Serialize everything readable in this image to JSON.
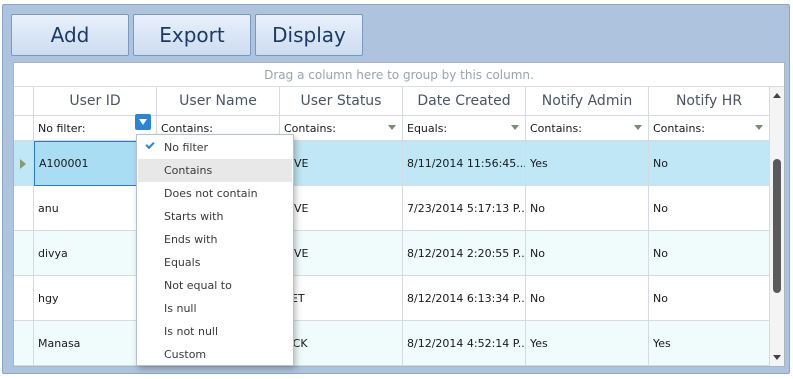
{
  "toolbar": {
    "add_label": "Add",
    "export_label": "Export",
    "display_label": "Display"
  },
  "group_panel_text": "Drag a column here to group by this column.",
  "columns": [
    "User ID",
    "User Name",
    "User Status",
    "Date Created",
    "Notify Admin",
    "Notify HR"
  ],
  "filters": [
    "No filter:",
    "Contains:",
    "Contains:",
    "Equals:",
    "Contains:",
    "Contains:"
  ],
  "rows": [
    {
      "user_id": "A100001",
      "user_status": "TIVE",
      "date_created": "8/11/2014 11:56:45...",
      "notify_admin": "Yes",
      "notify_hr": "No"
    },
    {
      "user_id": "anu",
      "user_status": "TIVE",
      "date_created": "7/23/2014 5:17:13 P...",
      "notify_admin": "No",
      "notify_hr": "No"
    },
    {
      "user_id": "divya",
      "user_status": "TIVE",
      "date_created": "8/12/2014 2:20:55 P...",
      "notify_admin": "No",
      "notify_hr": "No"
    },
    {
      "user_id": "hgy",
      "user_status": "SET",
      "date_created": "8/12/2014 6:13:34 P...",
      "notify_admin": "No",
      "notify_hr": "No"
    },
    {
      "user_id": "Manasa",
      "user_status": "OCK",
      "date_created": "8/12/2014 4:52:14 P...",
      "notify_admin": "Yes",
      "notify_hr": "Yes"
    }
  ],
  "filter_menu": {
    "selected": "No filter",
    "highlighted": "Contains",
    "items": [
      "No filter",
      "Contains",
      "Does not contain",
      "Starts with",
      "Ends with",
      "Equals",
      "Not equal to",
      "Is null",
      "Is not null",
      "Custom"
    ]
  },
  "colors": {
    "accent": "#2a85d6",
    "selected_row": "#bfe7f6",
    "alt_row": "#f0fbfc",
    "toolbar_bg": "#aec4de"
  },
  "icons": [
    "filter-funnel-icon",
    "checkmark-icon",
    "row-indicator-arrow-icon",
    "scroll-up-arrow-icon",
    "scroll-down-arrow-icon"
  ]
}
